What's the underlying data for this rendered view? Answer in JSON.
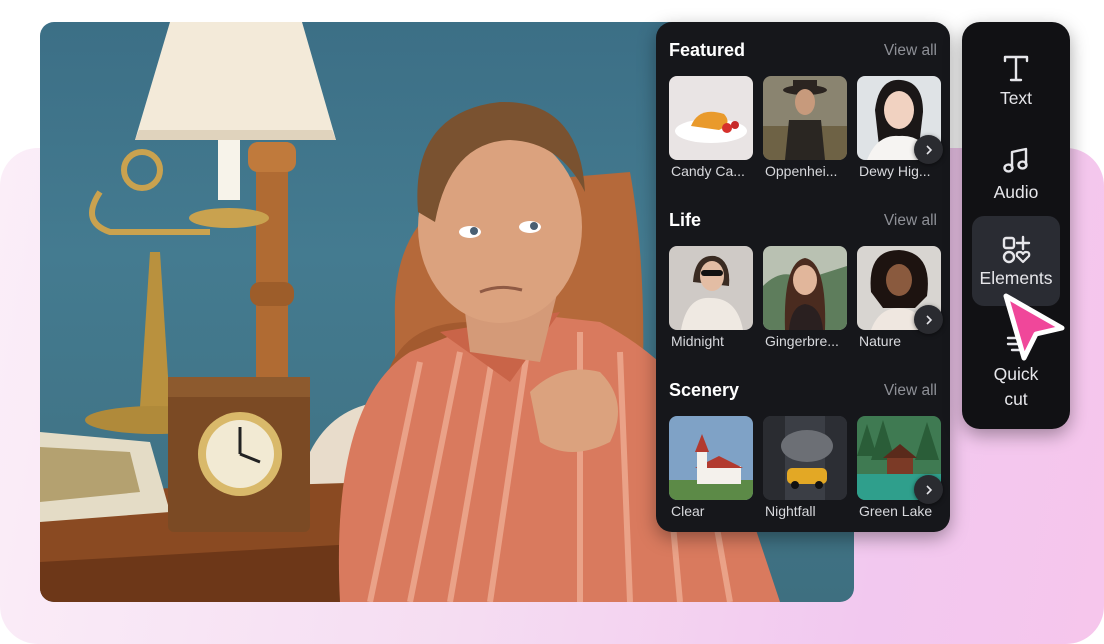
{
  "sections": [
    {
      "title": "Featured",
      "view_all": "View all",
      "items": [
        {
          "label": "Candy Ca..."
        },
        {
          "label": "Oppenhei..."
        },
        {
          "label": "Dewy Hig..."
        }
      ]
    },
    {
      "title": "Life",
      "view_all": "View all",
      "items": [
        {
          "label": "Midnight"
        },
        {
          "label": "Gingerbre..."
        },
        {
          "label": "Nature"
        }
      ]
    },
    {
      "title": "Scenery",
      "view_all": "View all",
      "items": [
        {
          "label": "Clear"
        },
        {
          "label": "Nightfall"
        },
        {
          "label": "Green Lake"
        }
      ]
    }
  ],
  "toolbar": {
    "text_label": "Text",
    "audio_label": "Audio",
    "elements_label": "Elements",
    "quick_cut_line1": "Quick",
    "quick_cut_line2": "cut",
    "active": "Elements"
  },
  "colors": {
    "panel_bg": "#16171b",
    "toolbar_bg": "#111114",
    "cursor": "#f0479a",
    "glow": "#f2c8ef"
  },
  "icons": [
    "text-icon",
    "audio-icon",
    "elements-icon",
    "quick-cut-icon",
    "chevron-right-icon",
    "pointer-cursor-icon"
  ]
}
